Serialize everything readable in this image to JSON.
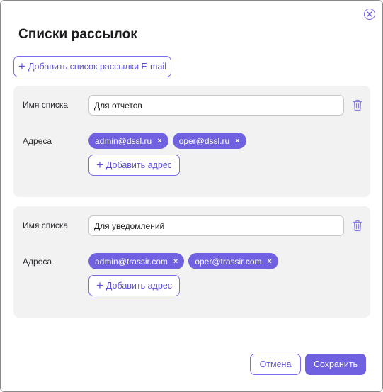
{
  "dialog": {
    "title": "Списки рассылок",
    "close_icon": "close-circle-icon",
    "add_list_button": "Добавить список рассылки E-mail"
  },
  "lists": [
    {
      "name_label": "Имя списка",
      "name_value": "Для отчетов",
      "addresses_label": "Адреса",
      "addresses": [
        "admin@dssl.ru",
        "oper@dssl.ru"
      ],
      "add_address_button": "Добавить адрес"
    },
    {
      "name_label": "Имя списка",
      "name_value": "Для уведомлений",
      "addresses_label": "Адреса",
      "addresses": [
        "admin@trassir.com",
        "oper@trassir.com"
      ],
      "add_address_button": "Добавить адрес"
    }
  ],
  "footer": {
    "cancel_label": "Отмена",
    "save_label": "Сохранить"
  },
  "colors": {
    "accent": "#6f61e0",
    "card_bg": "#f2f2f3",
    "chip_text": "#ffffff"
  },
  "chip_remove_glyph": "×",
  "plus_glyph": "+"
}
